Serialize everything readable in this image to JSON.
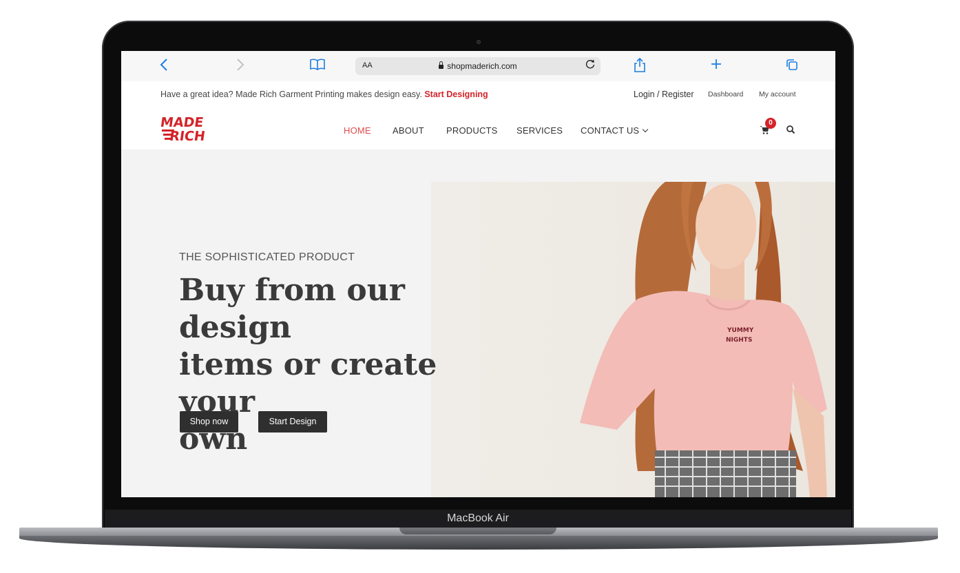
{
  "device": {
    "label": "MacBook Air"
  },
  "browser": {
    "url": "shopmaderich.com",
    "text_size_label": "AA",
    "icons": [
      "back-icon",
      "forward-icon",
      "bookmarks-icon",
      "lock-icon",
      "reload-icon",
      "share-icon",
      "new-tab-icon",
      "tabs-icon"
    ]
  },
  "topbar": {
    "promo_text": "Have a great idea? Made Rich Garment Printing makes design easy.",
    "promo_link": "Start Designing",
    "login": "Login / Register",
    "dashboard": "Dashboard",
    "my_account": "My account"
  },
  "logo": {
    "line1": "MADE",
    "line2": "RICH",
    "color": "#d3242a"
  },
  "nav": {
    "home": "HOME",
    "about": "ABOUT",
    "products": "PRODUCTS",
    "services": "SERVICES",
    "contact": "CONTACT US",
    "cart_count": "0"
  },
  "hero": {
    "eyebrow": "THE SOPHISTICATED PRODUCT",
    "headline_line1": "Buy from our design",
    "headline_line2": "items or create your",
    "headline_line3": "own",
    "shop_button": "Shop now",
    "design_button": "Start Design",
    "shirt_print_line1": "YUMMY",
    "shirt_print_line2": "NIGHTS"
  },
  "colors": {
    "accent": "#d3242a",
    "nav_active": "#e04a4a",
    "button": "#2f2f2f",
    "browser_blue": "#1a7de2"
  }
}
